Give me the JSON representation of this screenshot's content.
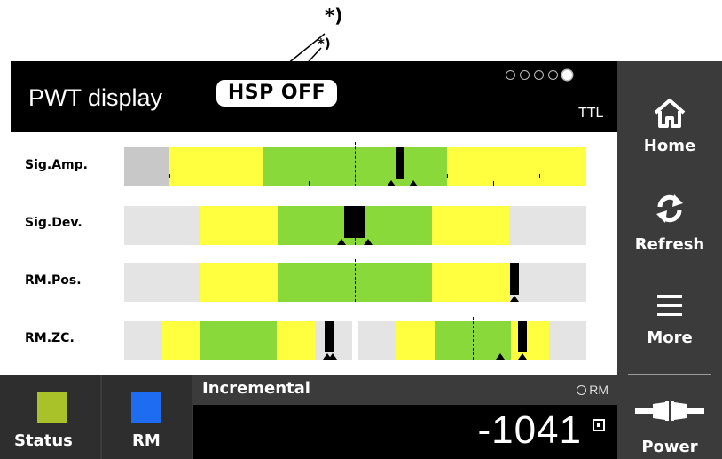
{
  "footnotes": {
    "top": "*)",
    "inner": "*)"
  },
  "header": {
    "title": "PWT display",
    "badge": "HSP OFF",
    "mode": "TTL",
    "page_dots": {
      "count": 5,
      "active": 5
    }
  },
  "sidebar": {
    "items": [
      {
        "label": "Home",
        "icon": "home-icon"
      },
      {
        "label": "Refresh",
        "icon": "refresh-icon"
      },
      {
        "label": "More",
        "icon": "menu-icon"
      },
      {
        "label": "Power",
        "icon": "power-connector-icon"
      }
    ]
  },
  "rows": [
    {
      "label": "Sig.Amp."
    },
    {
      "label": "Sig.Dev."
    },
    {
      "label": "RM.Pos."
    },
    {
      "label": "RM.ZC."
    }
  ],
  "bottom": {
    "status_label": "Status",
    "status_color": "#a9c22a",
    "rm_label": "RM",
    "rm_color": "#1e6cf0",
    "incremental_label": "Incremental",
    "rm_indicator": "RM",
    "value": "-1041"
  },
  "colors": {
    "yellow": "#ffff40",
    "green": "#8ad93a",
    "gray": "#e4e4e4",
    "darkgray": "#c8c8c8",
    "header": "#000000",
    "sidebar": "#3b3b3b"
  }
}
